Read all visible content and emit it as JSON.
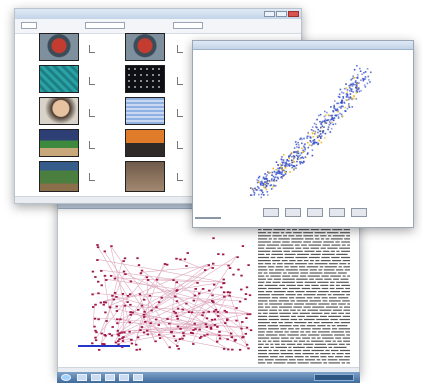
{
  "windows": {
    "thumbnail_browser": {},
    "japan_map": {
      "buttons": [
        {},
        {},
        {},
        {},
        {}
      ]
    },
    "network_graph": {}
  },
  "colors": {
    "map_points": "#3a53c9",
    "graph_nodes": "#a1174a",
    "taskbar": "#4f79a9"
  },
  "icons": [
    "close-icon",
    "maximize-icon",
    "minimize-icon",
    "start-icon"
  ]
}
